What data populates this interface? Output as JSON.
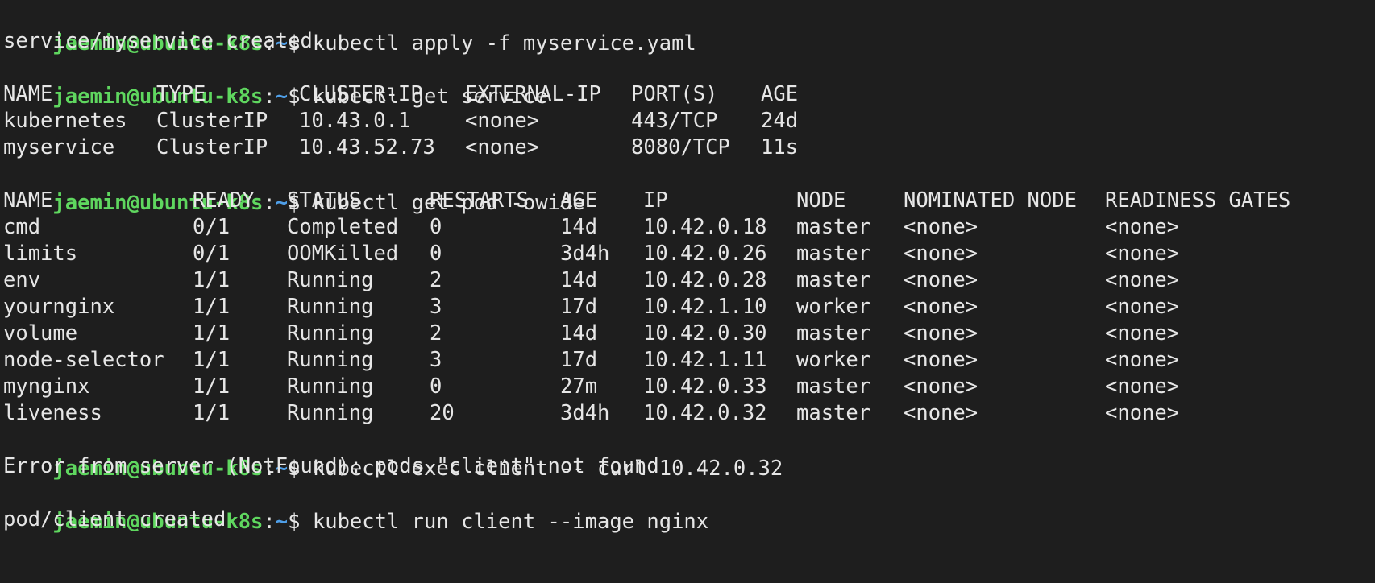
{
  "prompt": {
    "user_host": "jaemin@ubuntu-k8s",
    "colon": ":",
    "path": "~",
    "symbol": "$ ",
    "colors": {
      "user": "#5fd75f",
      "path": "#4f9fe8",
      "text": "#e6e6e6",
      "background": "#1e1e1e"
    }
  },
  "commands": [
    {
      "cmd": "kubectl apply -f myservice.yaml",
      "output": "service/myservice created"
    },
    {
      "cmd": "kubectl get service"
    },
    {
      "cmd": "kubectl get pod -owide"
    },
    {
      "cmd": "kubectl exec client -- curl 10.42.0.32",
      "output": "Error from server (NotFound): pods \"client\" not found"
    },
    {
      "cmd": "kubectl run client --image nginx",
      "output": "pod/client created"
    }
  ],
  "service_table": {
    "headers": [
      "NAME",
      "TYPE",
      "CLUSTER-IP",
      "EXTERNAL-IP",
      "PORT(S)",
      "AGE"
    ],
    "rows": [
      [
        "kubernetes",
        "ClusterIP",
        "10.43.0.1",
        "<none>",
        "443/TCP",
        "24d"
      ],
      [
        "myservice",
        "ClusterIP",
        "10.43.52.73",
        "<none>",
        "8080/TCP",
        "11s"
      ]
    ]
  },
  "pod_table": {
    "headers": [
      "NAME",
      "READY",
      "STATUS",
      "RESTARTS",
      "AGE",
      "IP",
      "NODE",
      "NOMINATED NODE",
      "READINESS GATES"
    ],
    "rows": [
      [
        "cmd",
        "0/1",
        "Completed",
        "0",
        "14d",
        "10.42.0.18",
        "master",
        "<none>",
        "<none>"
      ],
      [
        "limits",
        "0/1",
        "OOMKilled",
        "0",
        "3d4h",
        "10.42.0.26",
        "master",
        "<none>",
        "<none>"
      ],
      [
        "env",
        "1/1",
        "Running",
        "2",
        "14d",
        "10.42.0.28",
        "master",
        "<none>",
        "<none>"
      ],
      [
        "yournginx",
        "1/1",
        "Running",
        "3",
        "17d",
        "10.42.1.10",
        "worker",
        "<none>",
        "<none>"
      ],
      [
        "volume",
        "1/1",
        "Running",
        "2",
        "14d",
        "10.42.0.30",
        "master",
        "<none>",
        "<none>"
      ],
      [
        "node-selector",
        "1/1",
        "Running",
        "3",
        "17d",
        "10.42.1.11",
        "worker",
        "<none>",
        "<none>"
      ],
      [
        "mynginx",
        "1/1",
        "Running",
        "0",
        "27m",
        "10.42.0.33",
        "master",
        "<none>",
        "<none>"
      ],
      [
        "liveness",
        "1/1",
        "Running",
        "20",
        "3d4h",
        "10.42.0.32",
        "master",
        "<none>",
        "<none>"
      ]
    ]
  }
}
